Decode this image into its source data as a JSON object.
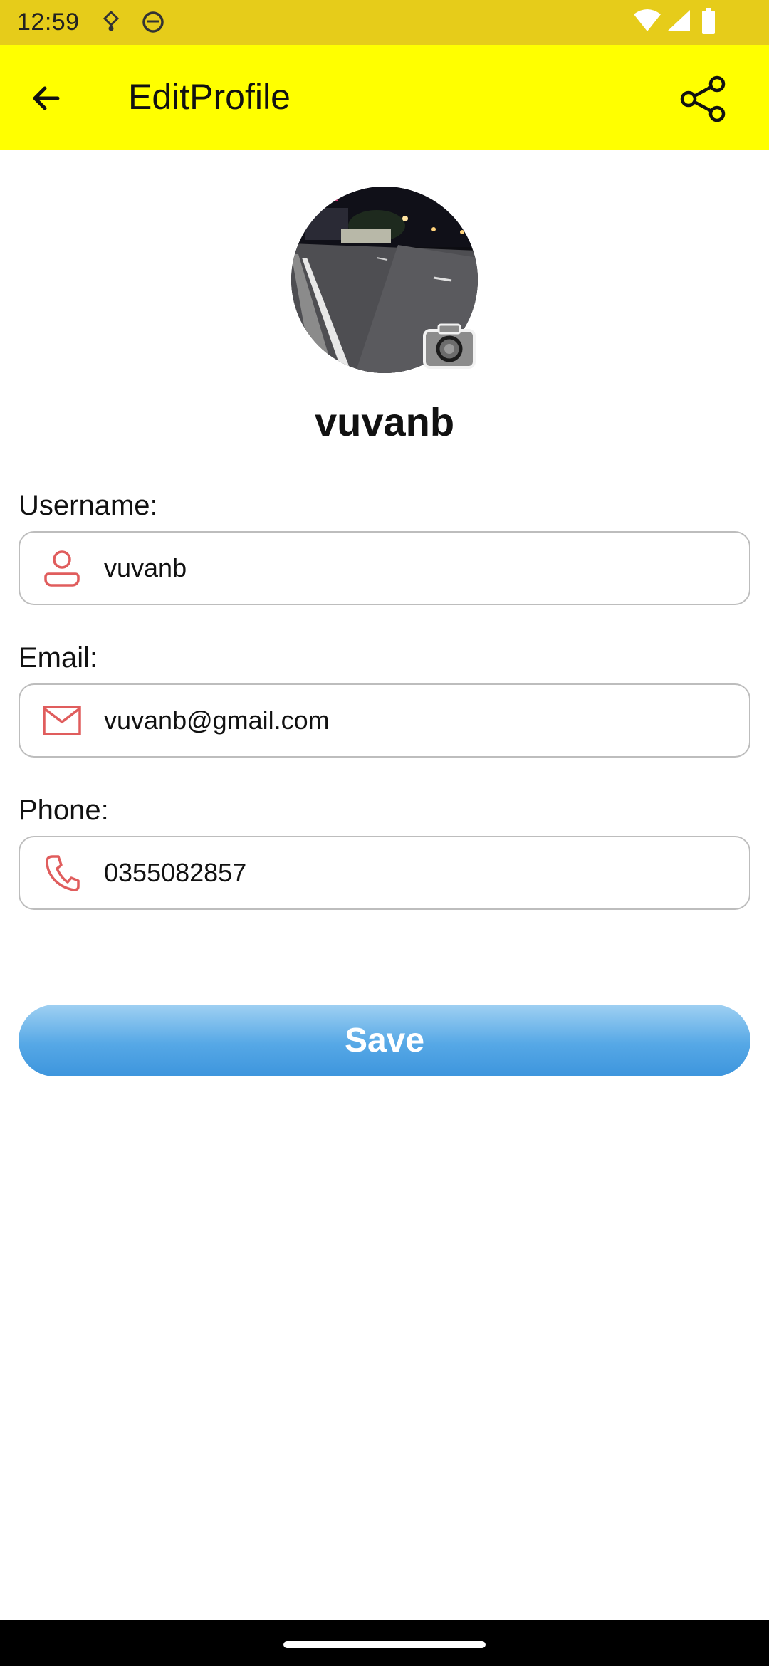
{
  "status_bar": {
    "time": "12:59",
    "icons": [
      "notification-icon",
      "face-icon",
      "wifi-icon",
      "signal-icon",
      "battery-icon"
    ]
  },
  "toolbar": {
    "title": "EditProfile",
    "back_icon": "arrow-left-icon",
    "share_icon": "share-icon",
    "background": "#ffff00"
  },
  "profile": {
    "display_name": "vuvanb",
    "avatar_icon": "avatar-photo",
    "camera_icon": "camera-icon"
  },
  "form": {
    "username": {
      "label": "Username:",
      "value": "vuvanb",
      "icon": "user-icon"
    },
    "email": {
      "label": "Email:",
      "value": "vuvanb@gmail.com",
      "icon": "mail-icon"
    },
    "phone": {
      "label": "Phone:",
      "value": "0355082857",
      "icon": "phone-icon"
    },
    "icon_color": "#e05d5d"
  },
  "actions": {
    "save_label": "Save",
    "save_color": "#4aa3e2"
  }
}
